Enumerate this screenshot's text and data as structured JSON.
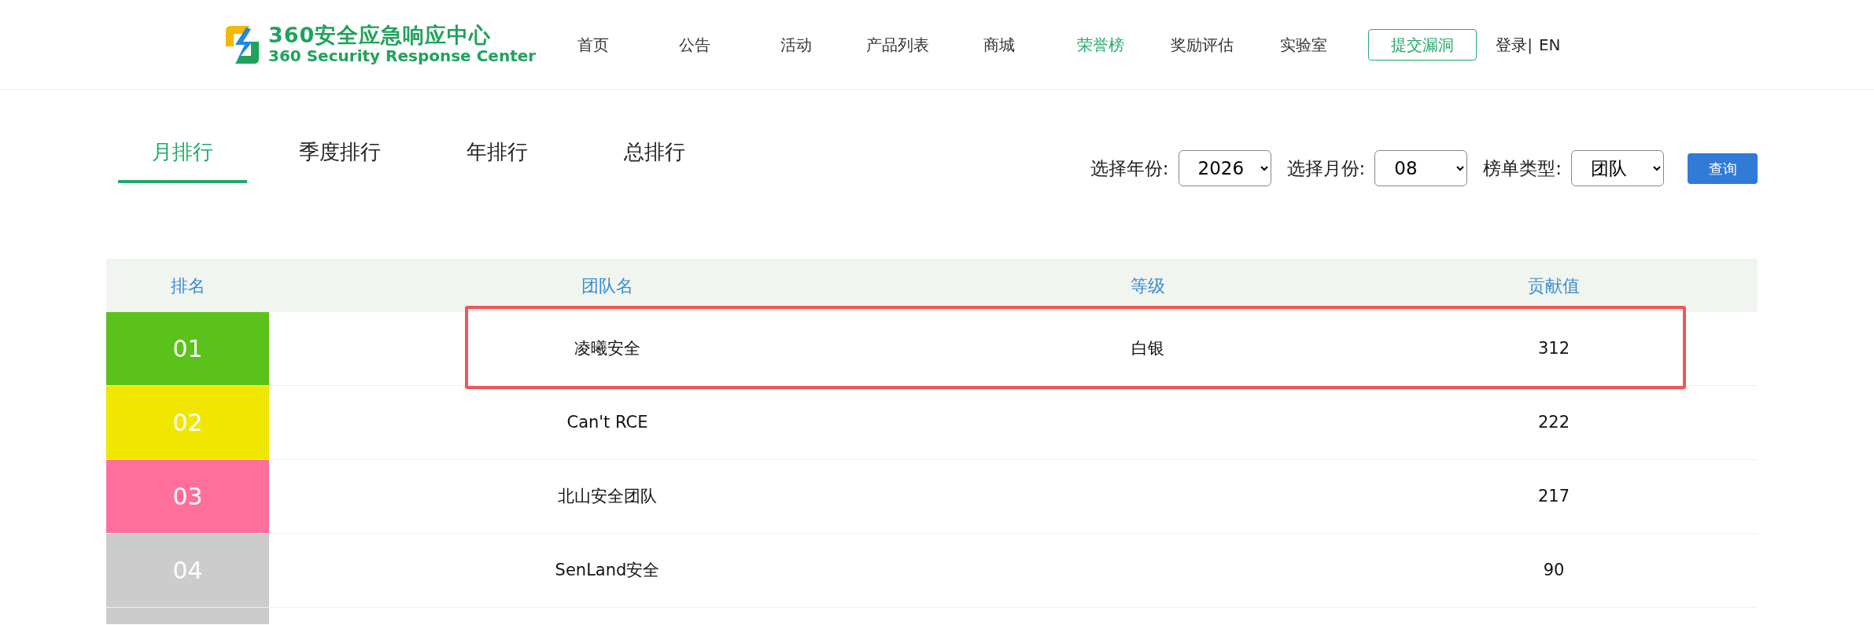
{
  "logo": {
    "title": "360安全应急响应中心",
    "subtitle": "360 Security Response Center"
  },
  "nav": [
    {
      "label": "首页",
      "selected": false
    },
    {
      "label": "公告",
      "selected": false
    },
    {
      "label": "活动",
      "selected": false
    },
    {
      "label": "产品列表",
      "selected": false
    },
    {
      "label": "商城",
      "selected": false
    },
    {
      "label": "荣誉榜",
      "selected": true
    },
    {
      "label": "奖励评估",
      "selected": false
    },
    {
      "label": "实验室",
      "selected": false
    }
  ],
  "submit_button": "提交漏洞",
  "login": "登录|",
  "language": "EN",
  "tabs": [
    {
      "label": "月排行",
      "selected": true
    },
    {
      "label": "季度排行",
      "selected": false
    },
    {
      "label": "年排行",
      "selected": false
    },
    {
      "label": "总排行",
      "selected": false
    }
  ],
  "filters": [
    {
      "label": "选择年份:",
      "value": "2026"
    },
    {
      "label": "选择月份:",
      "value": "08"
    },
    {
      "label": "榜单类型:",
      "value": "团队"
    }
  ],
  "query_button": "查询",
  "table": {
    "columns": [
      "排名",
      "团队名",
      "等级",
      "贡献值"
    ],
    "rows": [
      {
        "rank": "01",
        "color": "#5bc21c",
        "team": "凌曦安全",
        "level": "白银",
        "score": "312",
        "highlighted": true
      },
      {
        "rank": "02",
        "color": "#f0e600",
        "team": "Can't RCE",
        "score": "222",
        "highlighted": false
      },
      {
        "rank": "03",
        "color": "#ff6f9c",
        "team": "北山安全团队",
        "score": "217",
        "highlighted": false
      },
      {
        "rank": "04",
        "color": "#cccccc",
        "team": "SenLand安全",
        "score": "90",
        "highlighted": false
      }
    ],
    "cut_off_row": {
      "color": "#cccccc"
    }
  }
}
